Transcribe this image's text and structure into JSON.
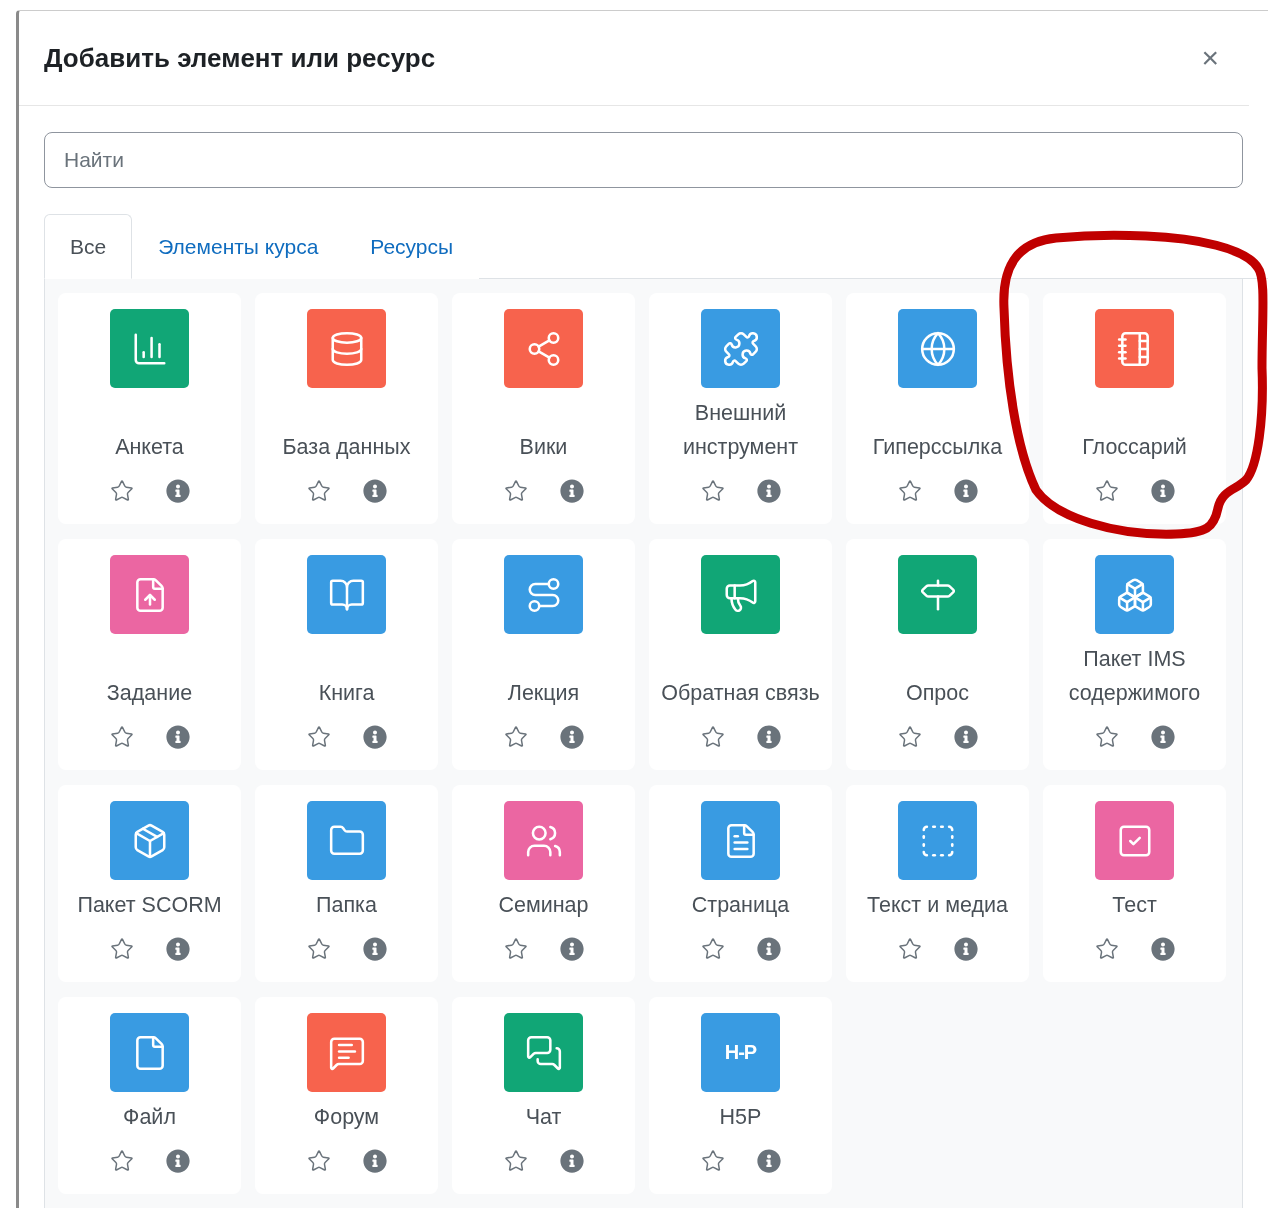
{
  "dialog": {
    "title": "Добавить элемент или ресурс",
    "close": "×"
  },
  "search": {
    "placeholder": "Найти"
  },
  "tabs": [
    {
      "label": "Все",
      "selected": true
    },
    {
      "label": "Элементы курса",
      "selected": false
    },
    {
      "label": "Ресурсы",
      "selected": false
    }
  ],
  "items": [
    {
      "name": "Анкета",
      "color": "#11a676",
      "starred": false
    },
    {
      "name": "База данных",
      "color": "#f7634d",
      "starred": false
    },
    {
      "name": "Вики",
      "color": "#f7634d",
      "starred": false
    },
    {
      "name": "Внешний инструмент",
      "color": "#399be2",
      "starred": false
    },
    {
      "name": "Гиперссылка",
      "color": "#399be2",
      "starred": false
    },
    {
      "name": "Глоссарий",
      "color": "#f7634d",
      "starred": false
    },
    {
      "name": "Задание",
      "color": "#eb66a2",
      "starred": false
    },
    {
      "name": "Книга",
      "color": "#399be2",
      "starred": false
    },
    {
      "name": "Лекция",
      "color": "#399be2",
      "starred": false
    },
    {
      "name": "Обратная связь",
      "color": "#11a676",
      "starred": false
    },
    {
      "name": "Опрос",
      "color": "#11a676",
      "starred": false
    },
    {
      "name": "Пакет IMS содержимого",
      "color": "#399be2",
      "starred": false
    },
    {
      "name": "Пакет SCORM",
      "color": "#399be2",
      "starred": false
    },
    {
      "name": "Папка",
      "color": "#399be2",
      "starred": false
    },
    {
      "name": "Семинар",
      "color": "#eb66a2",
      "starred": false
    },
    {
      "name": "Страница",
      "color": "#399be2",
      "starred": false
    },
    {
      "name": "Текст и медиа",
      "color": "#399be2",
      "starred": false
    },
    {
      "name": "Тест",
      "color": "#eb66a2",
      "starred": false
    },
    {
      "name": "Файл",
      "color": "#399be2",
      "starred": false
    },
    {
      "name": "Форум",
      "color": "#f7634d",
      "starred": false
    },
    {
      "name": "Чат",
      "color": "#11a676",
      "starred": false
    },
    {
      "name": "H5P",
      "color": "#399be2",
      "starred": false,
      "icon_text": "H-P"
    }
  ]
}
